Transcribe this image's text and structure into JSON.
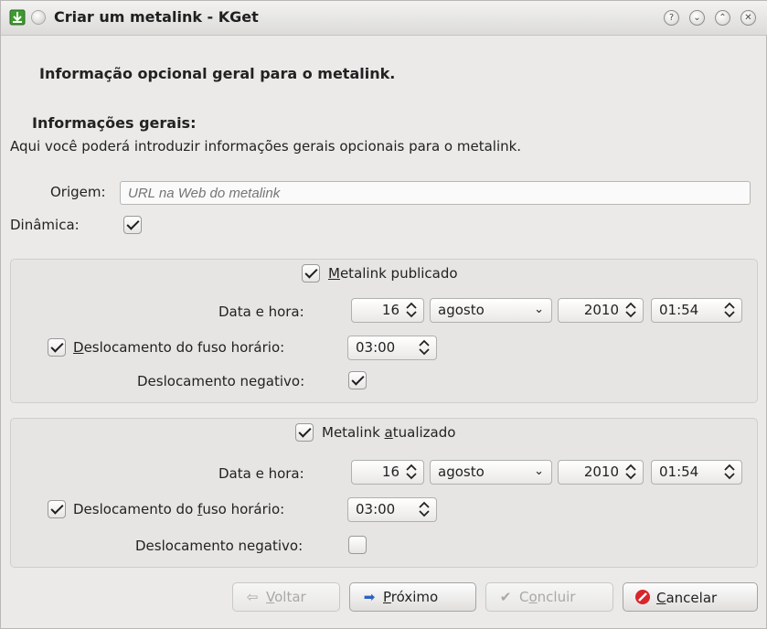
{
  "window": {
    "title": "Criar um metalink - KGet"
  },
  "page": {
    "heading": "Informação opcional geral para o metalink.",
    "section_title": "Informações gerais:",
    "section_desc": "Aqui você poderá introduzir informações gerais opcionais para o metalink."
  },
  "origin": {
    "label": "Origem:",
    "placeholder": "URL na Web do metalink"
  },
  "dynamic": {
    "label": "Dinâmica:",
    "checked": true
  },
  "published": {
    "check_label_mnemonic": "M",
    "check_label_rest": "etalink publicado",
    "checked": true,
    "date_label": "Data e hora:",
    "day": "16",
    "month": "agosto",
    "year": "2010",
    "time": "01:54",
    "tz_check_mnemonic": "D",
    "tz_check_rest": "eslocamento do fuso horário:",
    "tz_checked": true,
    "tz_value": "03:00",
    "negative_label": "Deslocamento negativo:",
    "negative_checked": true
  },
  "updated": {
    "check_label_pre": "Metalink ",
    "check_label_mnemonic": "a",
    "check_label_rest": "tualizado",
    "checked": true,
    "date_label": "Data e hora:",
    "day": "16",
    "month": "agosto",
    "year": "2010",
    "time": "01:54",
    "tz_check_pre": "Deslocamento do ",
    "tz_check_mnemonic": "f",
    "tz_check_rest": "uso horário:",
    "tz_checked": true,
    "tz_value": "03:00",
    "negative_label": "Deslocamento negativo:",
    "negative_checked": false
  },
  "buttons": {
    "back_mnemonic": "V",
    "back_rest": "oltar",
    "next_mnemonic": "P",
    "next_rest": "róximo",
    "finish_pre": "C",
    "finish_mnemonic": "o",
    "finish_rest": "ncluir",
    "cancel_mnemonic": "C",
    "cancel_rest": "ancelar"
  },
  "colors": {
    "next_arrow": "#2a63c6",
    "cancel_icon": "#d8262b",
    "app_icon": "#3f9a2f"
  }
}
